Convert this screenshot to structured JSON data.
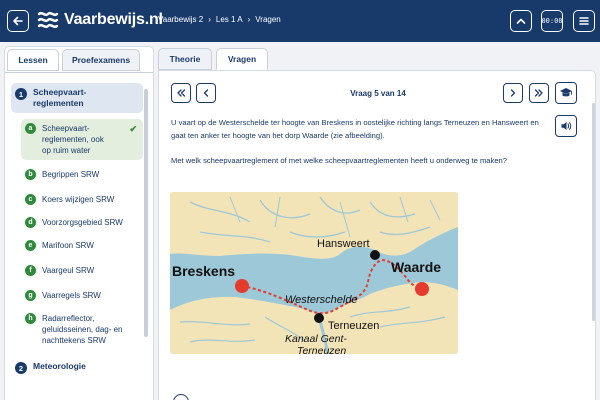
{
  "header": {
    "logo_text": "Vaarbewijs.nl",
    "breadcrumb": [
      "Vaarbewijs 2",
      "Les 1 A",
      "Vragen"
    ],
    "timer_label": "00:00",
    "icons": [
      "back-arrow-icon",
      "waves-logo-icon",
      "chevron-up-icon",
      "timer-icon",
      "menu-icon"
    ]
  },
  "left": {
    "tabs": [
      "Lessen",
      "Proefexamens"
    ],
    "chapters": [
      {
        "num": "1",
        "title": "Scheepvaart-reglementen"
      },
      {
        "num": "2",
        "title": "Meteorologie"
      }
    ],
    "lessons": [
      {
        "letter": "a",
        "title": "Scheepvaart-reglementen, ook op ruim water",
        "done": true
      },
      {
        "letter": "b",
        "title": "Begrippen SRW"
      },
      {
        "letter": "c",
        "title": "Koers wijzigen SRW"
      },
      {
        "letter": "d",
        "title": "Voorzorgsgebied SRW"
      },
      {
        "letter": "e",
        "title": "Marifoon SRW"
      },
      {
        "letter": "f",
        "title": "Vaargeul SRW"
      },
      {
        "letter": "g",
        "title": "Vaarregels SRW"
      },
      {
        "letter": "h",
        "title": "Radarreflector, geluidsseinen, dag- en nachttekens SRW"
      }
    ],
    "check_mark": "✔"
  },
  "right": {
    "tabs": [
      "Theorie",
      "Vragen"
    ],
    "question_counter": "Vraag 5 van 14",
    "question_text": "U vaart op de Westerschelde ter hoogte van Breskens in oostelijke richting langs Terneuzen en Hansweert en gaat ten anker ter hoogte van het dorp Waarde (zie afbeelding).",
    "question_prompt": "Met welk scheepvaartreglement of met welke scheepvaartreglementen heeft u onderweg te maken?",
    "map_labels": {
      "breskens": "Breskens",
      "waarde": "Waarde",
      "hansweert": "Hansweert",
      "westerschelde": "Westerschelde",
      "terneuzen": "Terneuzen",
      "kanaal_line1": "Kanaal Gent-",
      "kanaal_line2": "Terneuzen"
    },
    "icons": [
      "first-icon",
      "prev-icon",
      "next-icon",
      "last-icon",
      "graduation-cap-icon",
      "speaker-icon"
    ]
  },
  "colors": {
    "navy": "#173a6b",
    "water": "#9cc8d8",
    "land": "#f3e4b8",
    "route_red": "#e53b2f",
    "lesson_green": "#2f8a3c"
  }
}
